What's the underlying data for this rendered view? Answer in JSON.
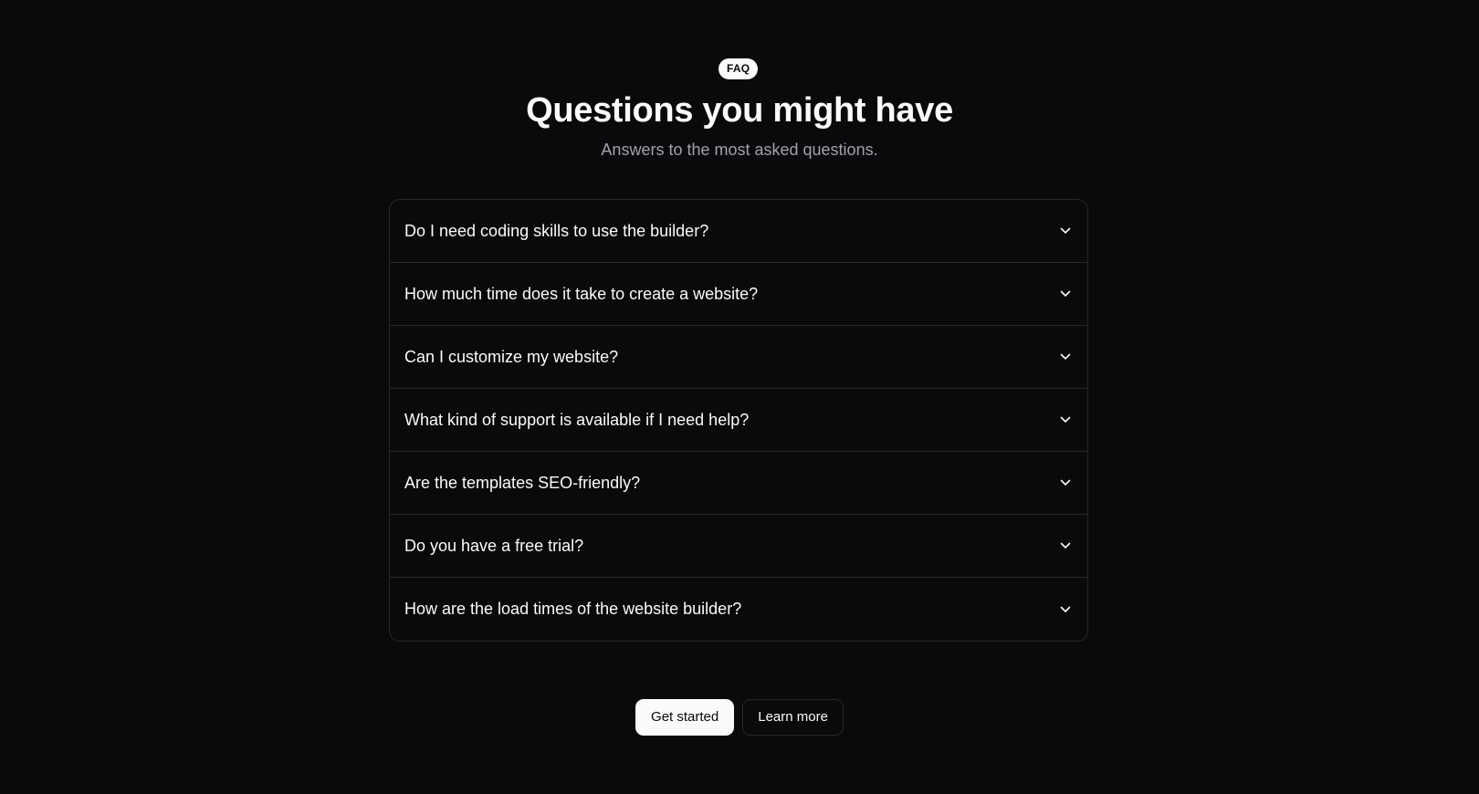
{
  "badge": "FAQ",
  "title": "Questions you might have",
  "subtitle": "Answers to the most asked questions.",
  "faq": {
    "items": [
      {
        "question": "Do I need coding skills to use the builder?",
        "icon": "chevron-down-icon"
      },
      {
        "question": "How much time does it take to create a website?",
        "icon": "chevron-down-icon"
      },
      {
        "question": "Can I customize my website?",
        "icon": "chevron-down-icon"
      },
      {
        "question": "What kind of support is available if I need help?",
        "icon": "chevron-down-icon"
      },
      {
        "question": "Are the templates SEO-friendly?",
        "icon": "chevron-down-icon"
      },
      {
        "question": "Do you have a free trial?",
        "icon": "chevron-down-icon"
      },
      {
        "question": "How are the load times of the website builder?",
        "icon": "chevron-down-icon"
      }
    ]
  },
  "actions": {
    "primary_label": "Get started",
    "secondary_label": "Learn more"
  },
  "colors": {
    "background": "#0a0a0c",
    "foreground": "#fafafa",
    "muted": "#a1a1aa",
    "border": "#27272a"
  }
}
